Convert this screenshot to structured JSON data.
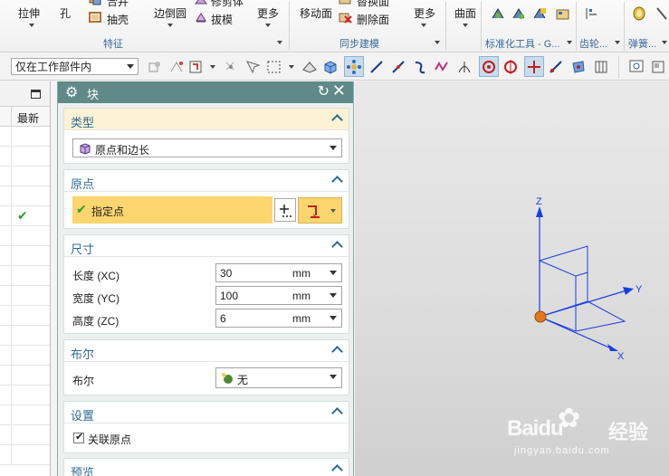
{
  "ribbon": {
    "items": {
      "lashen": "拉伸",
      "kong": "孔",
      "hebing": "合并",
      "chouke": "抽壳",
      "biandaoyuan": "边倒圆",
      "yingcangti": "修剪体",
      "bamo": "拔模",
      "gengduo1": "更多",
      "yidongmian": "移动面",
      "tihuanmian": "替换面",
      "shanchumian": "删除面",
      "gengduo2": "更多",
      "qumian": "曲面"
    },
    "groups": {
      "tezheng": "特征",
      "tongbujianmo": "同步建模",
      "biaozhunhua": "标准化工具 - G...",
      "chilun": "齿轮...",
      "tanhuang": "弹簧..."
    }
  },
  "toolbar": {
    "filter_value": "仅在工作部件内"
  },
  "navigator": {
    "column_header": "最新"
  },
  "dialog": {
    "title": "块",
    "sections": {
      "type": {
        "label": "类型",
        "value": "原点和边长"
      },
      "origin": {
        "label": "原点",
        "specify_point": "指定点"
      },
      "dimensions": {
        "label": "尺寸",
        "rows": [
          {
            "label": "长度 (XC)",
            "value": "30",
            "unit": "mm"
          },
          {
            "label": "宽度 (YC)",
            "value": "100",
            "unit": "mm"
          },
          {
            "label": "高度 (ZC)",
            "value": "6",
            "unit": "mm"
          }
        ]
      },
      "boolean": {
        "label": "布尔",
        "row_label": "布尔",
        "value": "无"
      },
      "settings": {
        "label": "设置",
        "checkbox_label": "关联原点",
        "checked": true
      },
      "preview": {
        "label": "预览"
      }
    }
  },
  "viewport": {
    "axes": {
      "x": "X",
      "y": "Y",
      "z": "Z"
    },
    "watermark": {
      "logo_text": "Bai",
      "logo_text2": "du",
      "jingyan": "经验",
      "url": "jingyan.baidu.com"
    }
  },
  "colors": {
    "dialog_title_bar": "#5f8a88",
    "highlight": "#fbd56d",
    "axis_blue": "#1a3fe0",
    "origin_orange": "#e07a1f"
  }
}
